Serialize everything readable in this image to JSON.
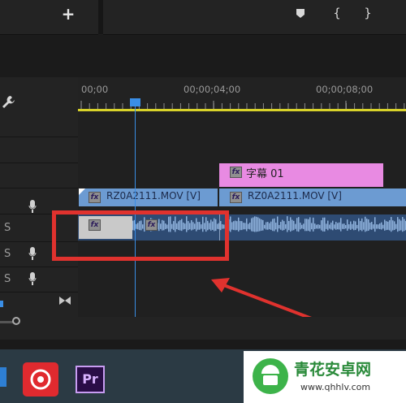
{
  "timecodes": [
    "00;00",
    "00;00;04;00",
    "00;00;08;00"
  ],
  "clips": {
    "title_clip": "字幕 01",
    "video_clip_1": "RZ0A2111.MOV [V]",
    "video_clip_2": "RZ0A2111.MOV [V]",
    "fx_label": "fx"
  },
  "track_headers": {
    "audio_labels": [
      "S",
      "S",
      "S"
    ]
  },
  "taskbar": {
    "premiere_label": "Pr"
  },
  "watermark": {
    "title": "青花安卓网",
    "url": "www.qhhlv.com"
  },
  "colors": {
    "playhead": "#3a8ee6",
    "work_area": "#d8d22a",
    "video_clip": "#6c9bd2",
    "title_clip": "#e88ae2",
    "audio_clip": "#2e4b73",
    "annotation": "#e0322e"
  },
  "icons": {
    "add": "plus-icon",
    "marker": "marker-icon",
    "mark_in": "mark-in-icon",
    "mark_out": "mark-out-icon",
    "settings": "wrench-icon",
    "mic": "microphone-icon",
    "snap": "bowtie-icon"
  }
}
